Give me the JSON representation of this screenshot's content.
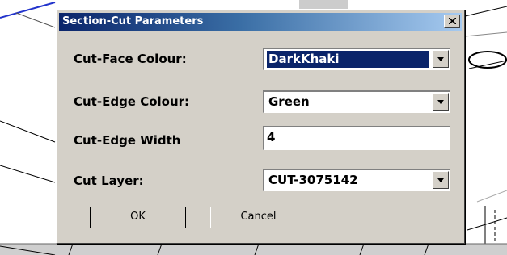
{
  "dialog": {
    "title": "Section-Cut Parameters",
    "close_symbol": "X",
    "fields": {
      "cut_face_colour": {
        "label": "Cut-Face Colour:",
        "value": "DarkKhaki"
      },
      "cut_edge_colour": {
        "label": "Cut-Edge Colour:",
        "value": "Green"
      },
      "cut_edge_width": {
        "label": "Cut-Edge Width",
        "value": "4"
      },
      "cut_layer": {
        "label": "Cut Layer:",
        "value": "CUT-3075142"
      }
    },
    "buttons": {
      "ok": "OK",
      "cancel": "Cancel"
    }
  },
  "colors": {
    "dialog_face": "#d4d0c8",
    "title_start": "#0a246a",
    "title_end": "#a6caf0",
    "selection": "#0a246a"
  }
}
